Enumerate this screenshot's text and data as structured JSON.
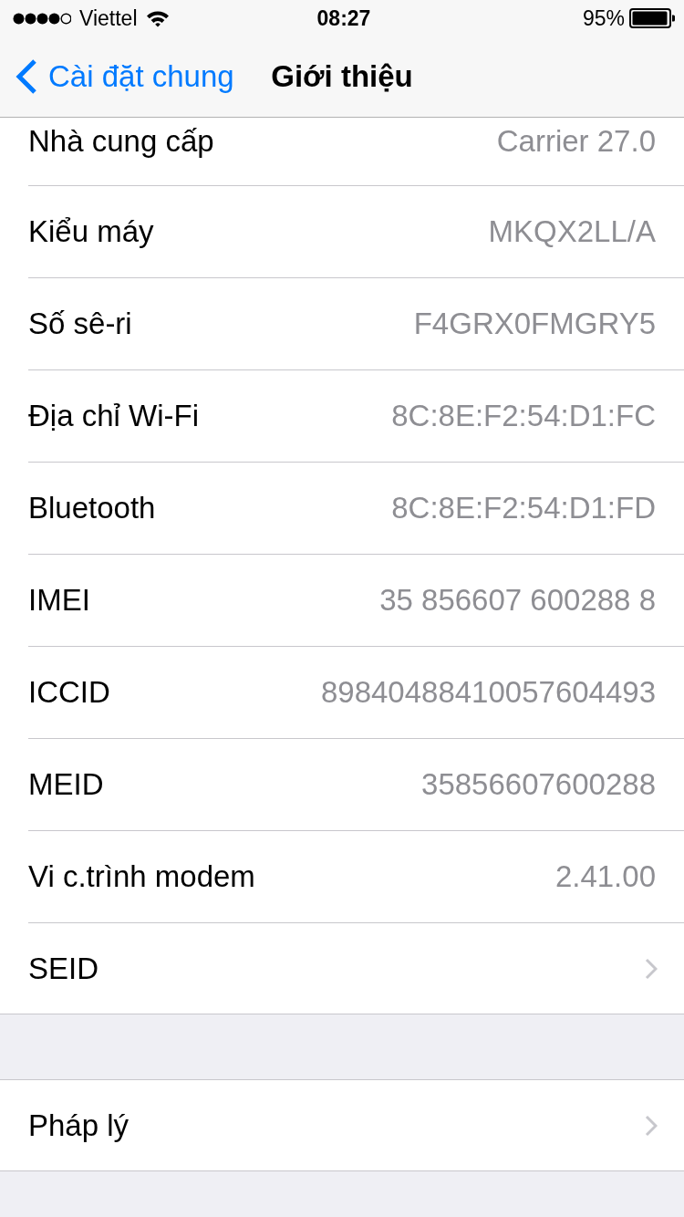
{
  "status_bar": {
    "carrier": "Viettel",
    "time": "08:27",
    "battery": "95%"
  },
  "nav_bar": {
    "back_label": "Cài đặt chung",
    "title": "Giới thiệu"
  },
  "groups": [
    {
      "rows": [
        {
          "kind": "value",
          "label": "Nhà cung cấp",
          "value": "Carrier 27.0"
        },
        {
          "kind": "value",
          "label": "Kiểu máy",
          "value": "MKQX2LL/A"
        },
        {
          "kind": "value",
          "label": "Số sê-ri",
          "value": "F4GRX0FMGRY5"
        },
        {
          "kind": "value",
          "label": "Địa chỉ Wi-Fi",
          "value": "8C:8E:F2:54:D1:FC"
        },
        {
          "kind": "value",
          "label": "Bluetooth",
          "value": "8C:8E:F2:54:D1:FD"
        },
        {
          "kind": "value",
          "label": "IMEI",
          "value": "35 856607 600288 8"
        },
        {
          "kind": "value",
          "label": "ICCID",
          "value": "89840488410057604493"
        },
        {
          "kind": "value",
          "label": "MEID",
          "value": "35856607600288"
        },
        {
          "kind": "value",
          "label": "Vi c.trình modem",
          "value": "2.41.00"
        },
        {
          "kind": "link",
          "label": "SEID"
        }
      ]
    },
    {
      "rows": [
        {
          "kind": "link",
          "label": "Pháp lý"
        }
      ]
    }
  ]
}
